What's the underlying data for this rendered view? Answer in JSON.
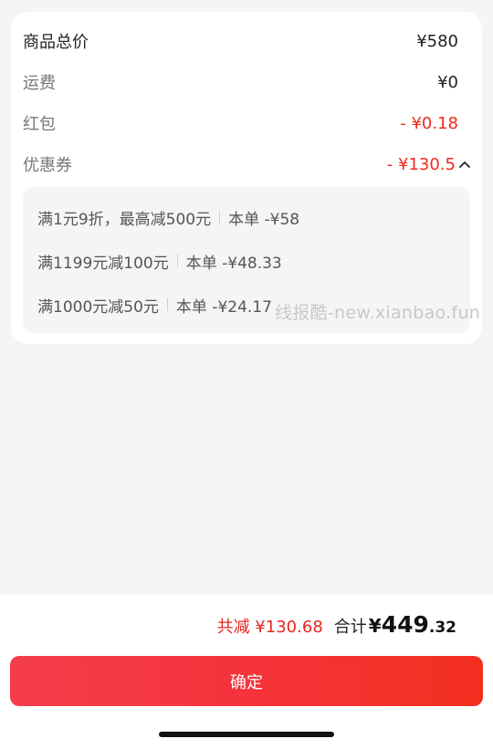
{
  "summary": {
    "goods_total_label": "商品总价",
    "goods_total_value": "¥580",
    "shipping_label": "运费",
    "shipping_value": "¥0",
    "redpacket_label": "红包",
    "redpacket_value": "- ¥0.18",
    "coupon_label": "优惠券",
    "coupon_value": "- ¥130.5"
  },
  "coupons": [
    {
      "condition": "满1元9折，最高减500元",
      "saving": "本单 -¥58"
    },
    {
      "condition": "满1199元减100元",
      "saving": "本单 -¥48.33"
    },
    {
      "condition": "满1000元减50元",
      "saving": "本单 -¥24.17"
    }
  ],
  "watermark": "线报酷-new.xianbao.fun",
  "footer": {
    "total_saved": "共减 ¥130.68",
    "total_label": "合计",
    "total_symbol": "¥",
    "total_integer": "449",
    "total_decimal": ".32",
    "confirm_label": "确定"
  },
  "colors": {
    "accent_red": "#f0281e",
    "button_gradient_start": "#f53d4c",
    "button_gradient_end": "#f3301f"
  },
  "icons": {
    "coupon_toggle": "chevron-up-icon"
  }
}
